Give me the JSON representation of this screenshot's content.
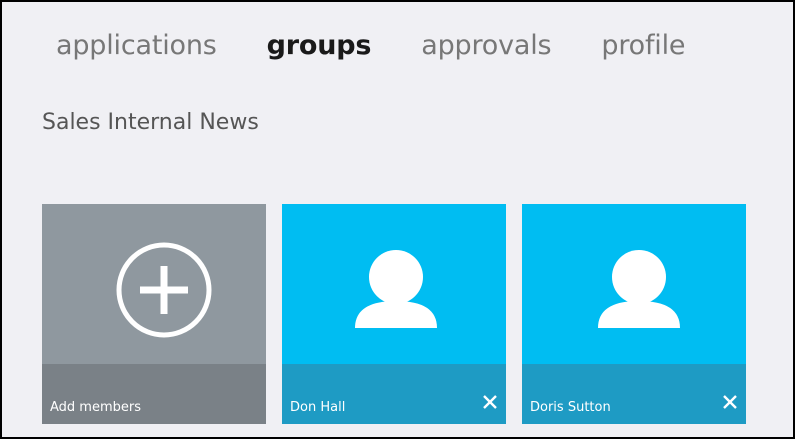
{
  "nav": {
    "items": [
      {
        "label": "applications",
        "active": false
      },
      {
        "label": "groups",
        "active": true
      },
      {
        "label": "approvals",
        "active": false
      },
      {
        "label": "profile",
        "active": false
      }
    ]
  },
  "group": {
    "title": "Sales Internal News"
  },
  "tiles": {
    "add": {
      "label": "Add members",
      "icon": "add-circle-icon"
    },
    "members": [
      {
        "name": "Don Hall",
        "icon": "user-silhouette-icon",
        "remove_icon": "close-icon"
      },
      {
        "name": "Doris Sutton",
        "icon": "user-silhouette-icon",
        "remove_icon": "close-icon"
      }
    ]
  },
  "colors": {
    "background": "#f0f0f4",
    "add_tile": "#8f989f",
    "add_tile_bar": "#7a8187",
    "member_tile": "#00bdf2",
    "member_tile_bar": "#1e9bc4"
  }
}
